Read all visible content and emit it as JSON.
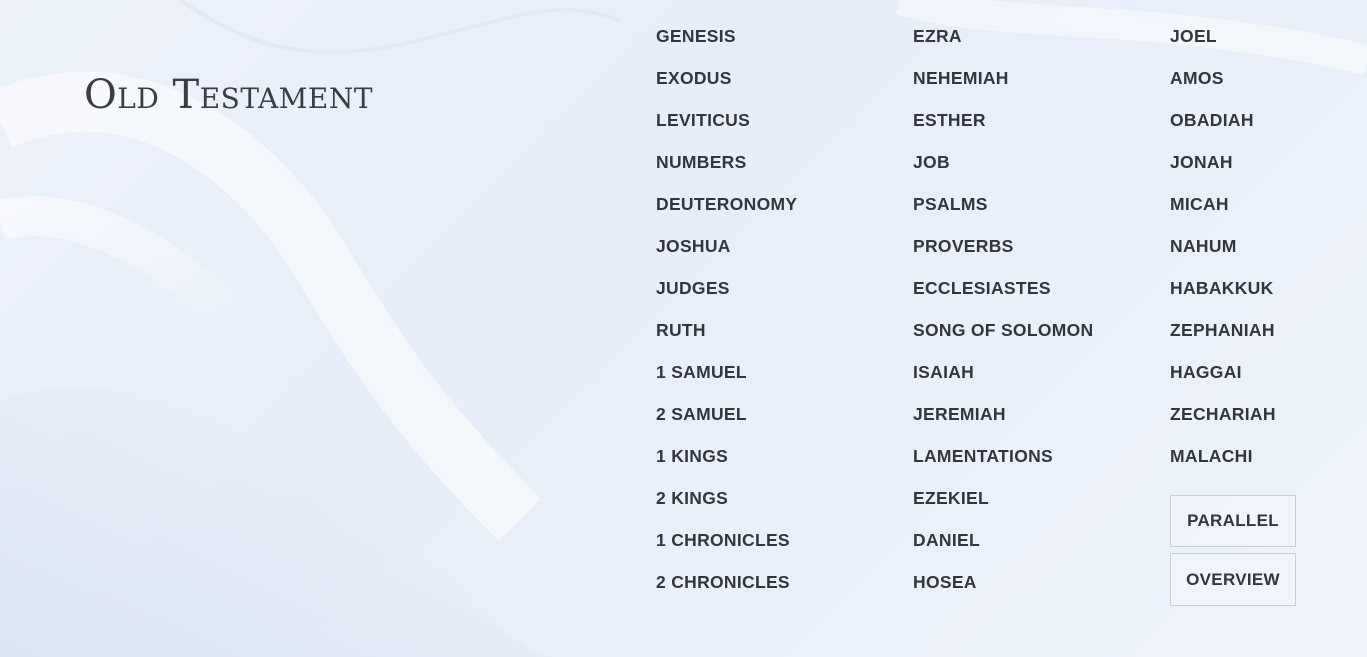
{
  "heading": "Old Testament",
  "columns": [
    [
      "GENESIS",
      "EXODUS",
      "LEVITICUS",
      "NUMBERS",
      "DEUTERONOMY",
      "JOSHUA",
      "JUDGES",
      "RUTH",
      "1 SAMUEL",
      "2 SAMUEL",
      "1 KINGS",
      "2 KINGS",
      "1 CHRONICLES",
      "2 CHRONICLES"
    ],
    [
      "EZRA",
      "NEHEMIAH",
      "ESTHER",
      "JOB",
      "PSALMS",
      "PROVERBS",
      "ECCLESIASTES",
      "SONG OF SOLOMON",
      "ISAIAH",
      "JEREMIAH",
      "LAMENTATIONS",
      "EZEKIEL",
      "DANIEL",
      "HOSEA"
    ],
    [
      "JOEL",
      "AMOS",
      "OBADIAH",
      "JONAH",
      "MICAH",
      "NAHUM",
      "HABAKKUK",
      "ZEPHANIAH",
      "HAGGAI",
      "ZECHARIAH",
      "MALACHI"
    ]
  ],
  "buttons": {
    "parallel": "PARALLEL",
    "overview": "OVERVIEW"
  },
  "colors": {
    "text": "#33363c",
    "heading": "#3a3d44",
    "background": "#eaf0f9",
    "button_border": "#c9cfd8"
  }
}
